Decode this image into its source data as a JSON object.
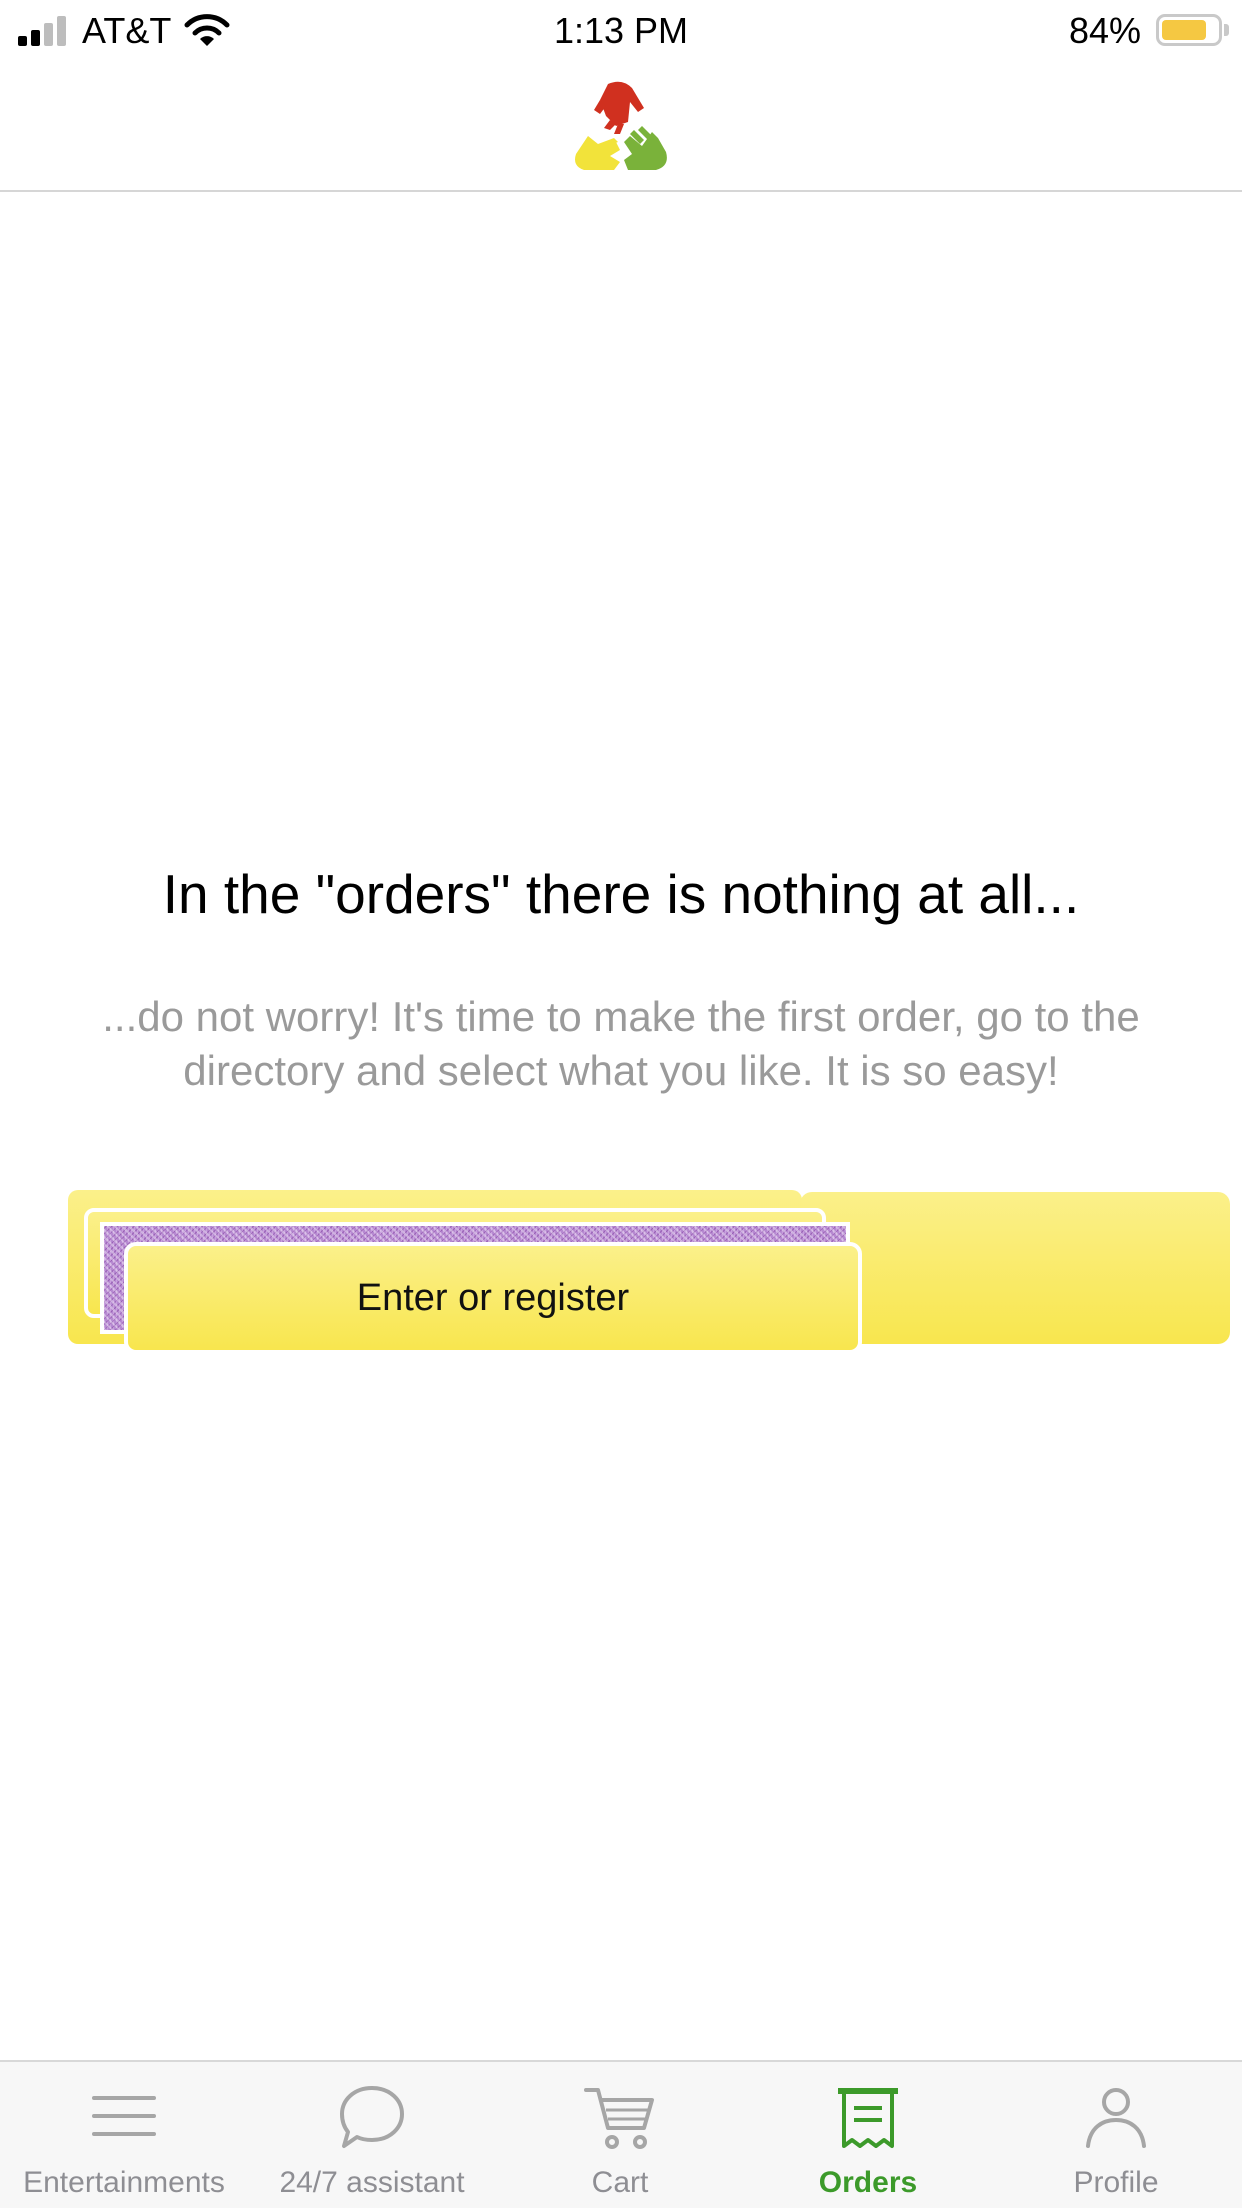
{
  "status_bar": {
    "carrier": "AT&T",
    "time": "1:13 PM",
    "battery_percent": "84%",
    "battery_level": 0.84,
    "signal_bars": 2,
    "icons": [
      "signal-icon",
      "wifi-icon",
      "battery-icon"
    ]
  },
  "header": {
    "logo": "hands-triangle-logo"
  },
  "empty_state": {
    "title": "In the \"orders\" there is nothing at all...",
    "subtitle": "...do not worry! It's time to make the first order, go to the directory and select what you like. It is so easy!",
    "button_label": "Enter or register"
  },
  "tabs": [
    {
      "label": "Entertainments",
      "icon": "menu-lines-icon",
      "active": false
    },
    {
      "label": "24/7 assistant",
      "icon": "chat-bubble-icon",
      "active": false
    },
    {
      "label": "Cart",
      "icon": "cart-icon",
      "active": false
    },
    {
      "label": "Orders",
      "icon": "receipt-icon",
      "active": true
    },
    {
      "label": "Profile",
      "icon": "person-icon",
      "active": false
    }
  ],
  "colors": {
    "accent_green": "#3c9a2a",
    "button_yellow": "#f8e64e",
    "battery_yellow": "#f5c842",
    "inactive_tab": "#8e8e93",
    "logo_red": "#d0301f",
    "logo_yellow": "#f2e33a",
    "logo_green": "#7ab23a"
  }
}
